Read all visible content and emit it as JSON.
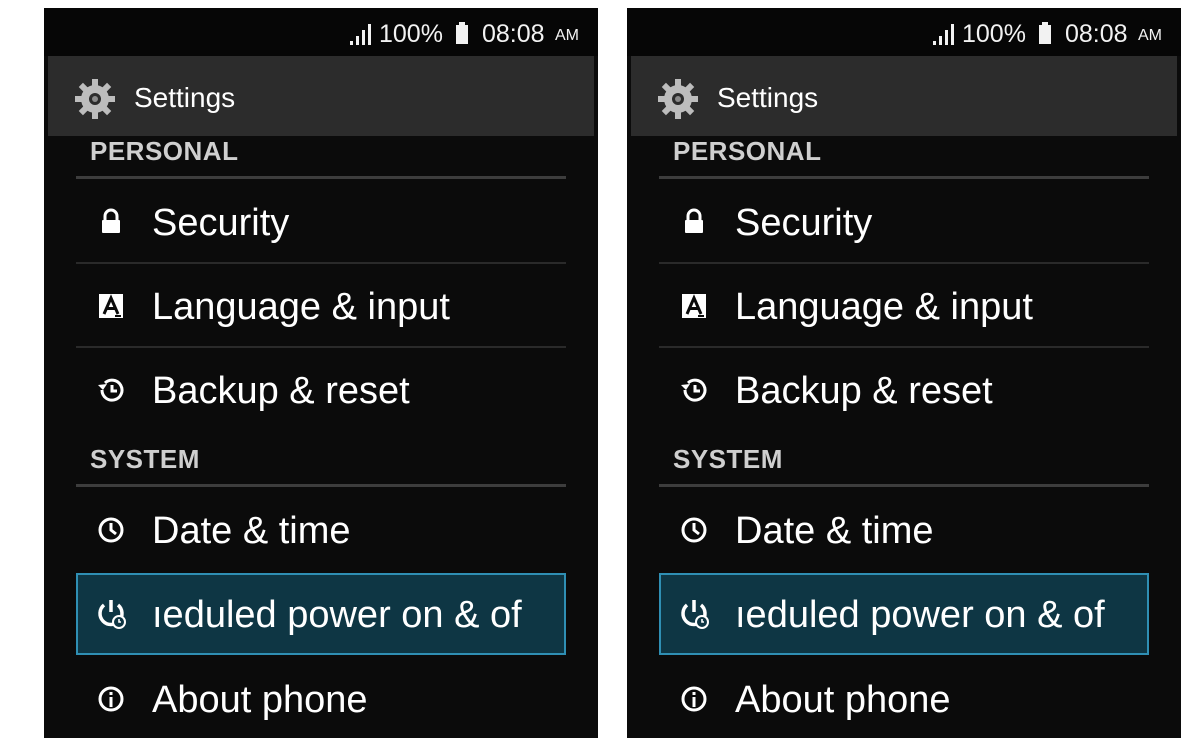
{
  "status_bar": {
    "battery_percent": "100%",
    "time": "08:08",
    "ampm": "AM",
    "icons": [
      "signal-icon",
      "battery-icon"
    ]
  },
  "action_bar": {
    "title": "Settings",
    "icon": "settings-gear-icon"
  },
  "sections": {
    "personal": {
      "header": "PERSONAL",
      "items": [
        {
          "label": "Security",
          "icon": "lock-icon"
        },
        {
          "label": "Language & input",
          "icon": "keyboard-a-icon"
        },
        {
          "label": "Backup & reset",
          "icon": "restore-icon"
        }
      ]
    },
    "system": {
      "header": "SYSTEM",
      "items": [
        {
          "label": "Date & time",
          "icon": "clock-icon"
        },
        {
          "label": "Scheduled power on & off",
          "visible_label": "ıeduled power on & of",
          "icon": "power-schedule-icon",
          "selected": true
        },
        {
          "label": "About phone",
          "icon": "info-icon"
        }
      ]
    }
  },
  "colors": {
    "background": "#0b0b0b",
    "action_bar": "#2c2c2c",
    "selected_fill": "#0e3644",
    "selected_border": "#2f8fb4",
    "section_header": "#cfcfcf"
  }
}
